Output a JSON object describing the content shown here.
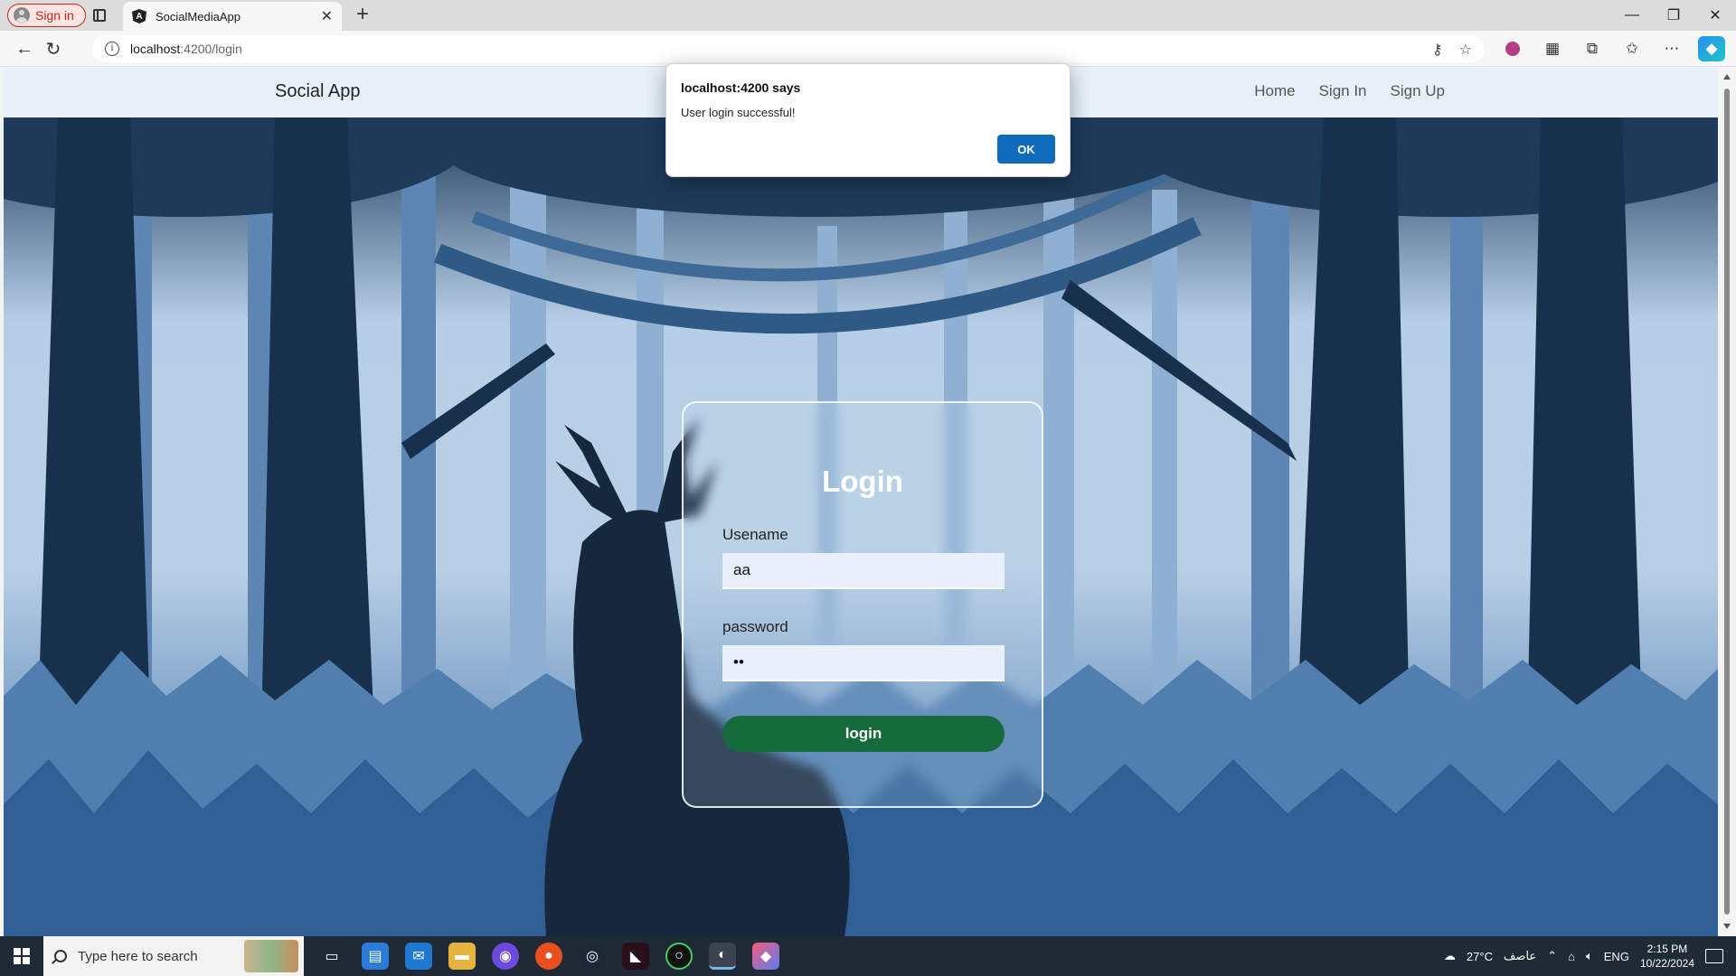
{
  "browser": {
    "profile_label": "Sign in",
    "tab_title": "SocialMediaApp",
    "tab_favicon": "A",
    "url_host": "localhost",
    "url_path": ":4200/login"
  },
  "app": {
    "brand": "Social App",
    "nav": {
      "home": "Home",
      "sign_in": "Sign In",
      "sign_up": "Sign Up"
    }
  },
  "login": {
    "title": "Login",
    "username_label": "Usename",
    "username_value": "aa",
    "password_label": "password",
    "password_value": "aa",
    "submit_label": "login"
  },
  "alert": {
    "title": "localhost:4200 says",
    "message": "User login successful!",
    "ok_label": "OK"
  },
  "taskbar": {
    "search_placeholder": "Type here to search",
    "weather": "27°C",
    "weather_desc": "عاصف",
    "language": "ENG",
    "time": "2:15 PM",
    "date": "10/22/2024"
  },
  "colors": {
    "login_button": "#166b3c",
    "alert_ok": "#0f6cbd",
    "navbar": "#e8f1fa"
  }
}
